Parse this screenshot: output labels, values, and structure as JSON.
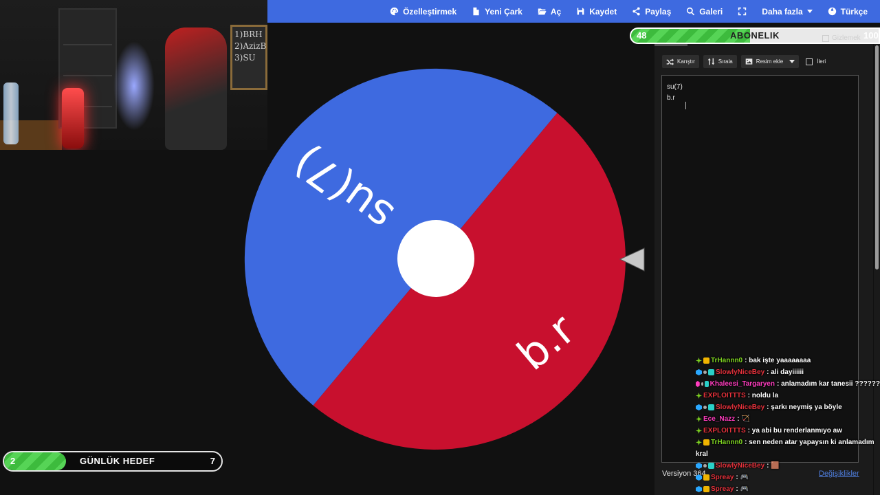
{
  "webcam": {
    "board_text": "1)BRH\n2)AzizB\n3)SU"
  },
  "nav": {
    "items": [
      {
        "name": "customize",
        "label": "Özelleştirmek",
        "icon": "palette-icon"
      },
      {
        "name": "new-wheel",
        "label": "Yeni Çark",
        "icon": "file-icon"
      },
      {
        "name": "open",
        "label": "Aç",
        "icon": "folder-open-icon"
      },
      {
        "name": "save",
        "label": "Kaydet",
        "icon": "save-icon"
      },
      {
        "name": "share",
        "label": "Paylaş",
        "icon": "share-icon"
      },
      {
        "name": "gallery",
        "label": "Galeri",
        "icon": "search-icon"
      },
      {
        "name": "fullscreen",
        "label": "",
        "icon": "fullscreen-icon"
      },
      {
        "name": "more",
        "label": "Daha fazla",
        "icon": "chevron-down-icon"
      },
      {
        "name": "language",
        "label": "Türkçe",
        "icon": "globe-icon"
      }
    ]
  },
  "wheel": {
    "segments": [
      {
        "label": "su(7)",
        "color": "#3e6ae0"
      },
      {
        "label": "b.r",
        "color": "#c8102e"
      }
    ],
    "hub_color": "#ffffff",
    "pointer_color": "#c8c8c8"
  },
  "subscription": {
    "label": "ABONELIK",
    "current": "48",
    "max": "100",
    "progress": 0.48
  },
  "panel": {
    "hide_label": "Gizlemek",
    "shuffle_label": "Karıştır",
    "sort_label": "Sırala",
    "add_image_label": "Resim ekle",
    "advanced_label": "İleri",
    "entries": [
      "su(7)",
      "b.r"
    ],
    "version": "Versiyon 364",
    "changes_label": "Değişiklikler"
  },
  "chat": [
    {
      "badges": [
        "b-green",
        "b-crown"
      ],
      "user": "TrHannn0",
      "color": "u-green",
      "msg": ": bak işte yaaaaaaaa"
    },
    {
      "badges": [
        "b-cube",
        "b-dot",
        "b-gem"
      ],
      "user": "SlowlyNiceBey",
      "color": "u-red",
      "msg": ": ali dayiiiiii"
    },
    {
      "badges": [
        "b-pink",
        "b-dot",
        "b-gem"
      ],
      "user": "Khaleesi_Targaryen",
      "color": "u-pink",
      "msg": ": anlamadım kar tanesii ??????"
    },
    {
      "badges": [
        "b-green"
      ],
      "user": "EXPLOITTTS",
      "color": "u-red",
      "msg": ": noldu la"
    },
    {
      "badges": [
        "b-cube",
        "b-dot",
        "b-gem"
      ],
      "user": "SlowlyNiceBey",
      "color": "u-red",
      "msg": ": şarkı neymiş ya böyle"
    },
    {
      "badges": [
        "b-green"
      ],
      "user": "Ece_Nazz",
      "color": "u-pink",
      "msg": ": 🏹"
    },
    {
      "badges": [
        "b-green"
      ],
      "user": "EXPLOITTTS",
      "color": "u-red",
      "msg": ": ya abi bu renderlanmıyo aw"
    },
    {
      "badges": [
        "b-green",
        "b-crown"
      ],
      "user": "TrHannn0",
      "color": "u-green",
      "msg": ": sen neden atar yapaysın ki anlamadım kral",
      "wrap": true
    },
    {
      "badges": [
        "b-cube",
        "b-dot",
        "b-gem"
      ],
      "user": "SlowlyNiceBey",
      "color": "u-red",
      "msg": ": 🟫"
    },
    {
      "badges": [
        "b-cube",
        "b-crown"
      ],
      "user": "Spreay",
      "color": "u-red",
      "msg": ": 🎮"
    },
    {
      "badges": [
        "b-cube",
        "b-crown"
      ],
      "user": "Spreay",
      "color": "u-red",
      "msg": ": 🎮"
    }
  ],
  "goal": {
    "label": "GÜNLÜK HEDEF",
    "current": "2",
    "max": "7",
    "progress": 0.285
  }
}
